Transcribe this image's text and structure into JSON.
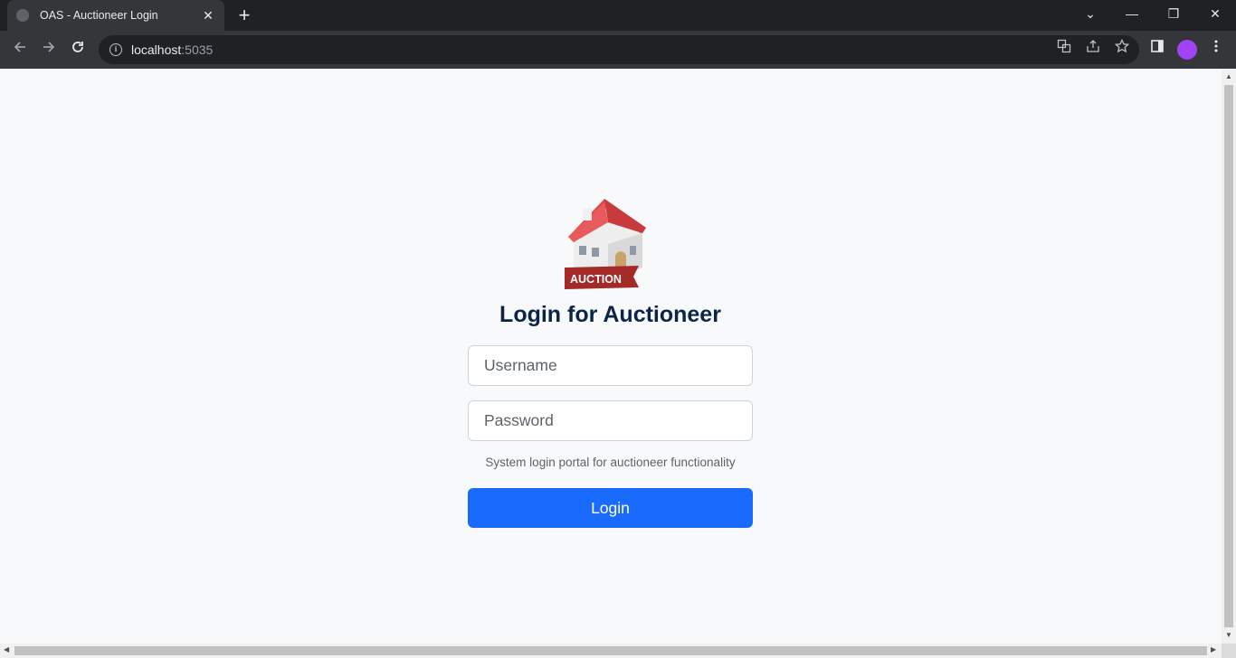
{
  "browser": {
    "tab_title": "OAS - Auctioneer Login",
    "tab_close": "✕",
    "new_tab": "+",
    "url_host": "localhost",
    "url_port": ":5035",
    "window_controls": {
      "tab_search": "⌄",
      "minimize": "—",
      "restore": "❐",
      "close": "✕"
    }
  },
  "page": {
    "logo_badge": "AUCTION",
    "heading": "Login for Auctioneer",
    "username_placeholder": "Username",
    "password_placeholder": "Password",
    "hint": "System login portal for auctioneer functionality",
    "login_label": "Login"
  },
  "colors": {
    "primary_button": "#1a6bfd",
    "heading": "#0b2447",
    "background": "#f8f9fa"
  }
}
